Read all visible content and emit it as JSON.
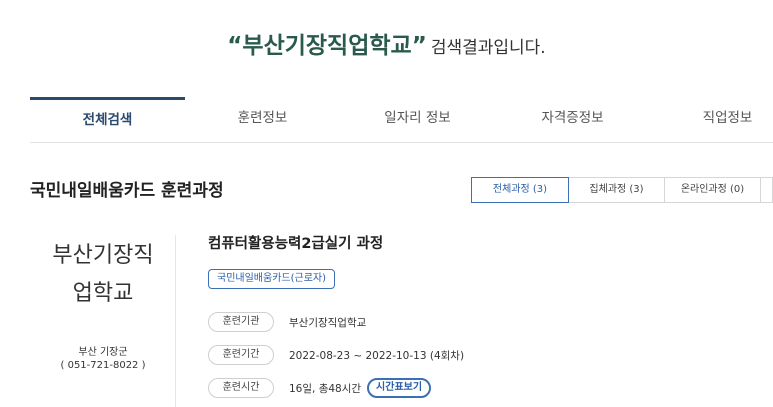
{
  "search": {
    "keyword": "“부산기장직업학교”",
    "suffix": "검색결과입니다."
  },
  "main_tabs": [
    {
      "label": "전체검색",
      "active": true
    },
    {
      "label": "훈련정보",
      "active": false
    },
    {
      "label": "일자리 정보",
      "active": false
    },
    {
      "label": "자격증정보",
      "active": false
    },
    {
      "label": "직업정보",
      "active": false
    }
  ],
  "section": {
    "title": "국민내일배움카드 훈련과정"
  },
  "sub_tabs": [
    {
      "label": "전체과정 (3)",
      "active": true
    },
    {
      "label": "집체과정 (3)",
      "active": false
    },
    {
      "label": "온라인과정 (0)",
      "active": false
    },
    {
      "label": "",
      "active": false
    }
  ],
  "org": {
    "name_line1": "부산기장직",
    "name_line2": "업학교",
    "address": "부산 기장군",
    "phone": "( 051-721-8022 )"
  },
  "course": {
    "title": "컴퓨터활용능력2급실기 과정",
    "badge": "국민내일배움카드(근로자)",
    "rows": [
      {
        "label": "훈련기관",
        "value": "부산기장직업학교"
      },
      {
        "label": "훈련기간",
        "value": "2022-08-23 ~ 2022-10-13 (4회차)"
      },
      {
        "label": "훈련시간",
        "value": "16일, 총48시간"
      }
    ],
    "schedule_button": "시간표보기"
  }
}
